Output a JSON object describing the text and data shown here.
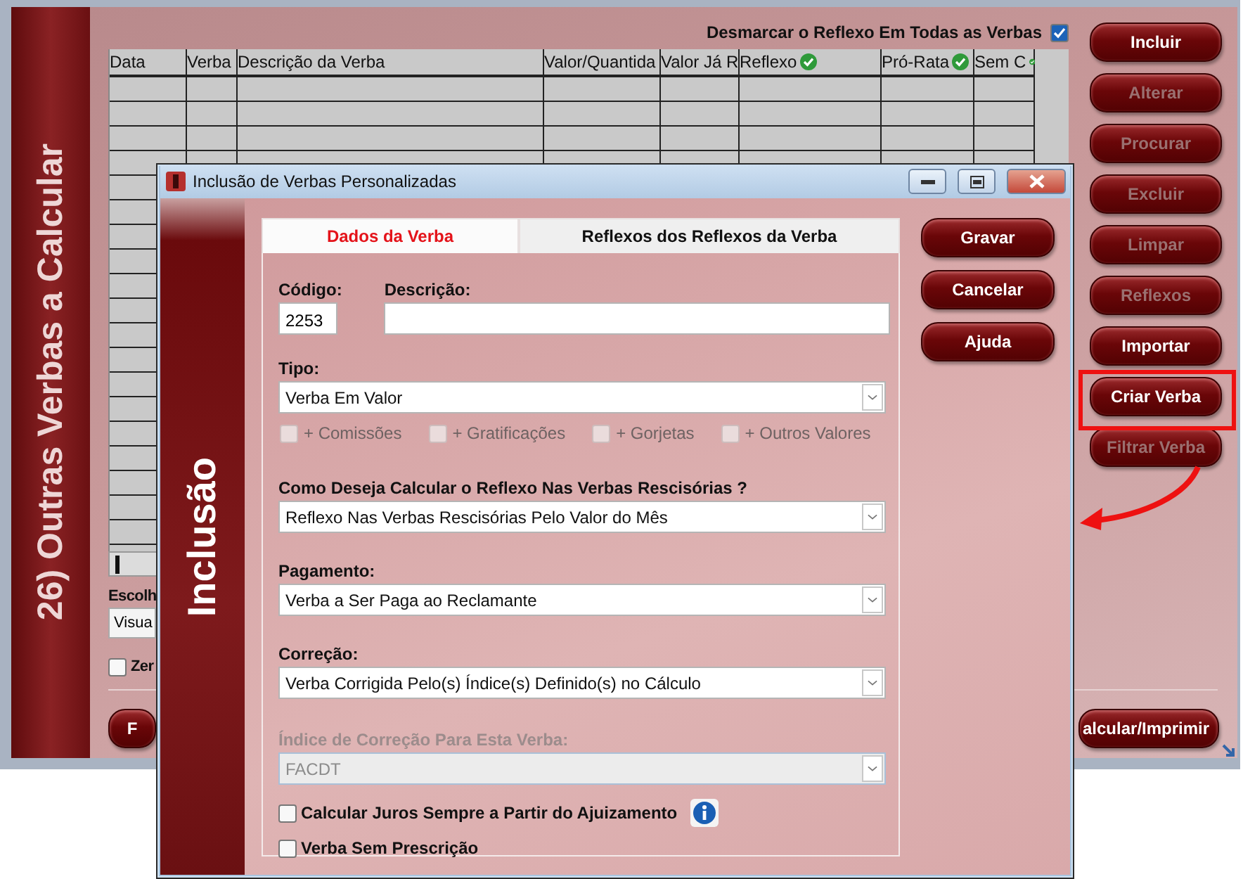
{
  "main_window": {
    "sidebar_title": "26) Outras Verbas a Calcular",
    "uncheck_all": {
      "label": "Desmarcar o Reflexo Em Todas as Verbas",
      "checked": true
    },
    "table": {
      "columns": [
        {
          "label": "Data",
          "kind": "plain"
        },
        {
          "label": "Verba",
          "kind": "plain"
        },
        {
          "label": "Descrição da Verba",
          "kind": "plain"
        },
        {
          "label": "Valor/Quantida",
          "kind": "plain"
        },
        {
          "label": "Valor Já R",
          "kind": "plain"
        },
        {
          "label": "Reflexo",
          "kind": "check"
        },
        {
          "label": "Pró-Rata",
          "kind": "check"
        },
        {
          "label": "Sem C",
          "kind": "check"
        }
      ]
    },
    "buttons": [
      {
        "label": "Incluir",
        "disabled": false,
        "highlighted": false
      },
      {
        "label": "Alterar",
        "disabled": true,
        "highlighted": false
      },
      {
        "label": "Procurar",
        "disabled": true,
        "highlighted": false
      },
      {
        "label": "Excluir",
        "disabled": true,
        "highlighted": false
      },
      {
        "label": "Limpar",
        "disabled": true,
        "highlighted": false
      },
      {
        "label": "Reflexos",
        "disabled": true,
        "highlighted": false
      },
      {
        "label": "Importar",
        "disabled": false,
        "highlighted": false
      },
      {
        "label": "Criar Verba",
        "disabled": false,
        "highlighted": true
      },
      {
        "label": "Filtrar Verba",
        "disabled": true,
        "highlighted": false
      }
    ],
    "choose_label": "Escolh",
    "view_select": {
      "value": "Visua"
    },
    "zero_checkbox": {
      "label": "Zer",
      "checked": false
    },
    "bottom_left_button": "F",
    "calculate_button": "alcular/Imprimir"
  },
  "dialog": {
    "title": "Inclusão de Verbas Personalizadas",
    "side_title": "Inclusão",
    "tabs": [
      {
        "label": "Dados da Verba",
        "selected": true
      },
      {
        "label": "Reflexos dos Reflexos da Verba",
        "selected": false
      }
    ],
    "code": {
      "label": "Código:",
      "value": "2253"
    },
    "description": {
      "label": "Descrição:"
    },
    "type": {
      "label": "Tipo:",
      "value": "Verba Em Valor",
      "disabled": false
    },
    "additions": [
      {
        "label": "+ Comissões",
        "checked": false,
        "disabled": true
      },
      {
        "label": "+ Gratificações",
        "checked": false,
        "disabled": true
      },
      {
        "label": "+ Gorjetas",
        "checked": false,
        "disabled": true
      },
      {
        "label": "+ Outros Valores",
        "checked": false,
        "disabled": true
      }
    ],
    "selects": [
      {
        "label": "Como Deseja Calcular o Reflexo Nas Verbas Rescisórias ?",
        "value": "Reflexo Nas Verbas Rescisórias Pelo Valor do Mês",
        "disabled": false
      },
      {
        "label": "Pagamento:",
        "value": "Verba a Ser Paga ao Reclamante",
        "disabled": false
      },
      {
        "label": "Correção:",
        "value": "Verba Corrigida Pelo(s) Índice(s) Definido(s) no Cálculo",
        "disabled": false
      },
      {
        "label": "Índice de Correção Para Esta Verba:",
        "value": "FACDT",
        "disabled": true
      }
    ],
    "options": [
      {
        "label": "Calcular Juros Sempre a Partir do Ajuizamento",
        "checked": false,
        "info": true
      },
      {
        "label": "Verba Sem Prescrição",
        "checked": false,
        "info": false
      }
    ],
    "buttons": [
      {
        "label": "Gravar"
      },
      {
        "label": "Cancelar"
      },
      {
        "label": "Ajuda"
      }
    ]
  }
}
